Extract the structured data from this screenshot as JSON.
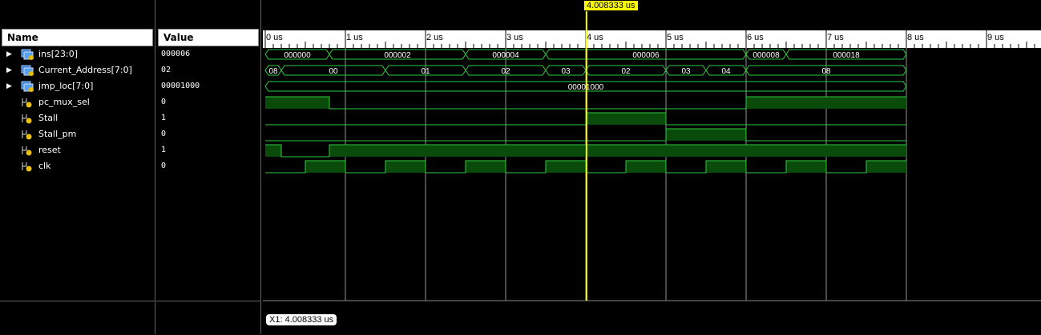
{
  "headers": {
    "name": "Name",
    "value": "Value"
  },
  "signals": [
    {
      "name": "ins[23:0]",
      "value": "000006",
      "icon": "bus-icon"
    },
    {
      "name": "Current_Address[7:0]",
      "value": "02",
      "icon": "bus-icon"
    },
    {
      "name": "jmp_loc[7:0]",
      "value": "00001000",
      "icon": "bus-icon"
    },
    {
      "name": "pc_mux_sel",
      "value": "0",
      "icon": "wire-icon"
    },
    {
      "name": "Stall",
      "value": "1",
      "icon": "wire-icon"
    },
    {
      "name": "Stall_pm",
      "value": "0",
      "icon": "wire-icon"
    },
    {
      "name": "reset",
      "value": "1",
      "icon": "wire-icon"
    },
    {
      "name": "clk",
      "value": "0",
      "icon": "wire-icon"
    }
  ],
  "timeline": {
    "ticks": [
      "0 us",
      "1 us",
      "2 us",
      "3 us",
      "4 us",
      "5 us",
      "6 us",
      "7 us",
      "8 us",
      "9 us"
    ],
    "marker_label": "4.008333 us",
    "marker_time": 4.008333,
    "cursor_readout": "X1: 4.008333 us"
  },
  "waves": {
    "ins": [
      {
        "t0": 0,
        "t1": 0.8,
        "v": "000000"
      },
      {
        "t0": 0.8,
        "t1": 2.5,
        "v": "000002"
      },
      {
        "t0": 2.5,
        "t1": 3.5,
        "v": "000004"
      },
      {
        "t0": 3.5,
        "t1": 6.0,
        "v": "000006"
      },
      {
        "t0": 6.0,
        "t1": 6.5,
        "v": "000008"
      },
      {
        "t0": 6.5,
        "t1": 8.0,
        "v": "000018"
      }
    ],
    "addr": [
      {
        "t0": 0,
        "t1": 0.2,
        "v": "08"
      },
      {
        "t0": 0.2,
        "t1": 1.5,
        "v": "00"
      },
      {
        "t0": 1.5,
        "t1": 2.5,
        "v": "01"
      },
      {
        "t0": 2.5,
        "t1": 3.5,
        "v": "02"
      },
      {
        "t0": 3.5,
        "t1": 4.0,
        "v": "03"
      },
      {
        "t0": 4.0,
        "t1": 5.0,
        "v": "02"
      },
      {
        "t0": 5.0,
        "t1": 5.5,
        "v": "03"
      },
      {
        "t0": 5.5,
        "t1": 6.0,
        "v": "04"
      },
      {
        "t0": 6.0,
        "t1": 8.0,
        "v": "08"
      }
    ],
    "jmp": [
      {
        "t0": 0,
        "t1": 8.0,
        "v": "00001000"
      }
    ],
    "pc_mux_sel": [
      {
        "t": 0,
        "v": 1
      },
      {
        "t": 0.8,
        "v": 0
      },
      {
        "t": 6.0,
        "v": 1
      },
      {
        "t": 8.0,
        "v": 1
      }
    ],
    "stall": [
      {
        "t": 0,
        "v": 0
      },
      {
        "t": 4.0,
        "v": 1
      },
      {
        "t": 5.0,
        "v": 0
      },
      {
        "t": 8.0,
        "v": 0
      }
    ],
    "stall_pm": [
      {
        "t": 0,
        "v": 0
      },
      {
        "t": 5.0,
        "v": 1
      },
      {
        "t": 6.0,
        "v": 0
      },
      {
        "t": 8.0,
        "v": 0
      }
    ],
    "reset": [
      {
        "t": 0,
        "v": 1
      },
      {
        "t": 0.2,
        "v": 0
      },
      {
        "t": 0.8,
        "v": 1
      },
      {
        "t": 8.0,
        "v": 1
      }
    ],
    "clk_period": 1.0,
    "clk_high_from": 0.5,
    "end_time": 8.0
  }
}
